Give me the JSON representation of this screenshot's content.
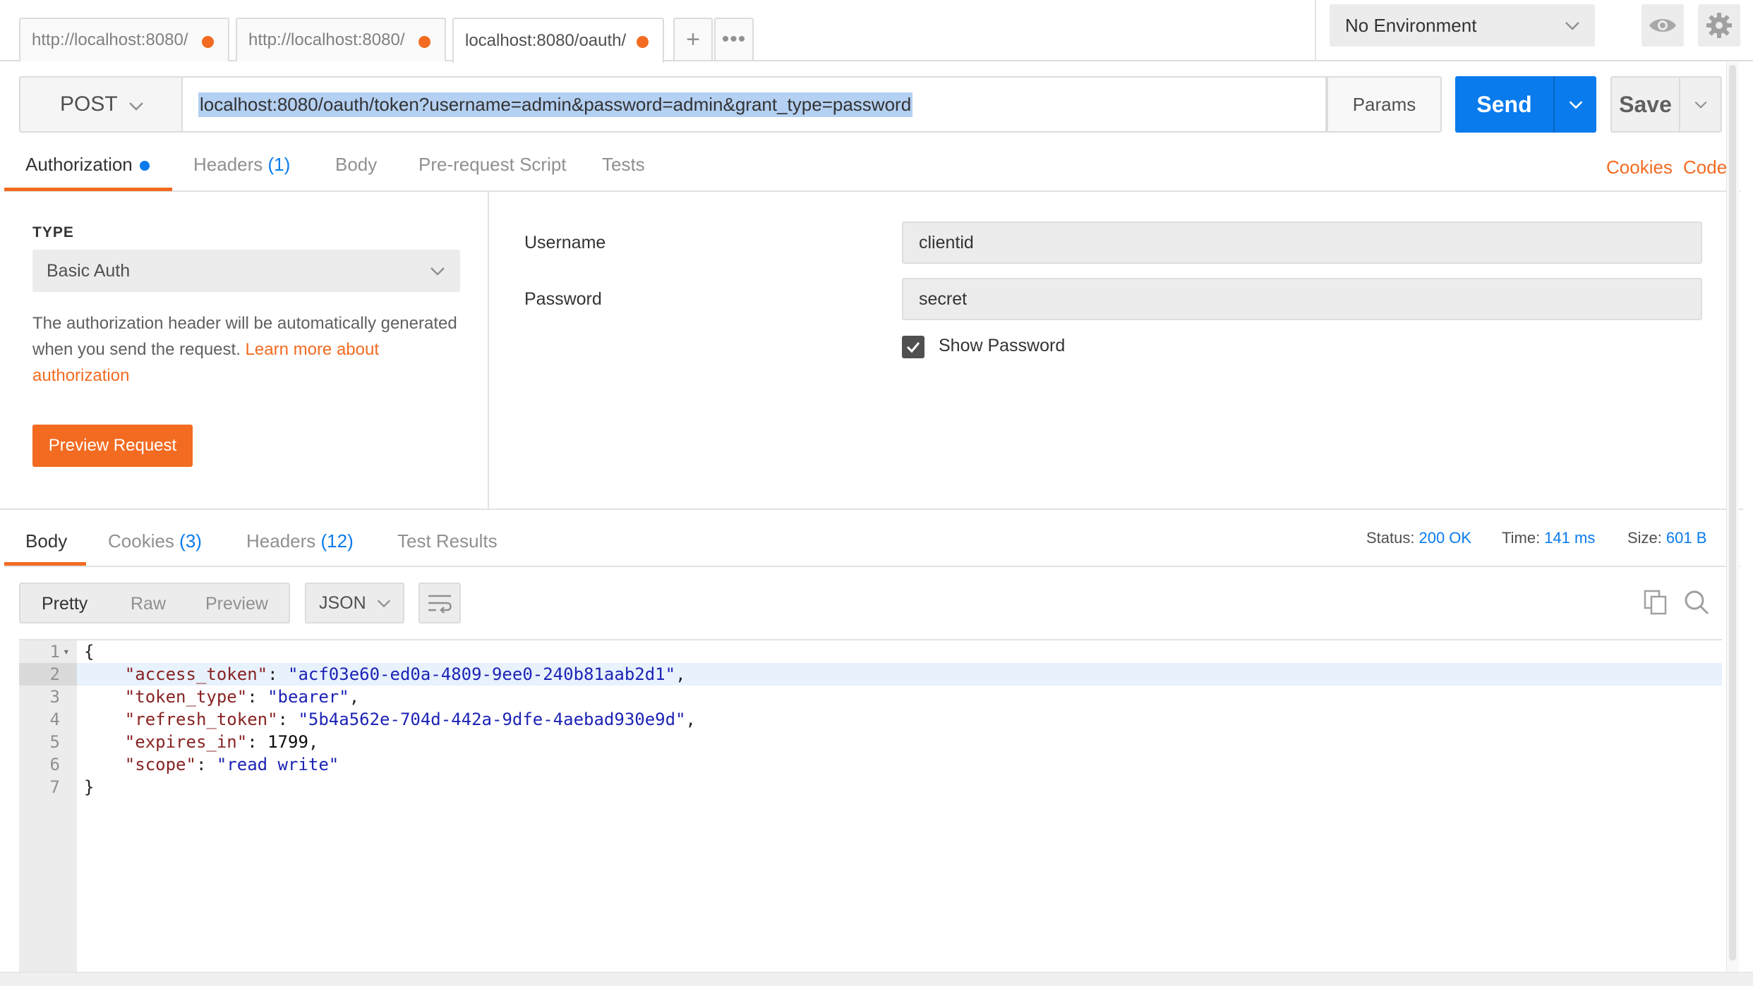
{
  "tabs": [
    {
      "label": "http://localhost:8080/"
    },
    {
      "label": "http://localhost:8080/"
    },
    {
      "label": "localhost:8080/oauth/"
    }
  ],
  "tab_buttons": {
    "new": "+",
    "more": "•••"
  },
  "environment": {
    "label": "No Environment"
  },
  "request": {
    "method": "POST",
    "url": "localhost:8080/oauth/token?username=admin&password=admin&grant_type=password",
    "params_label": "Params",
    "send_label": "Send",
    "save_label": "Save"
  },
  "request_tabs": {
    "authorization": "Authorization",
    "headers": "Headers",
    "headers_count": "(1)",
    "body": "Body",
    "pre_request": "Pre-request Script",
    "tests": "Tests",
    "cookies_link": "Cookies",
    "code_link": "Code"
  },
  "auth": {
    "type_label": "TYPE",
    "type_value": "Basic Auth",
    "desc_text": "The authorization header will be automatically generated when you send the request. ",
    "desc_link": "Learn more about authorization",
    "preview_label": "Preview Request",
    "username_label": "Username",
    "username_value": "clientid",
    "password_label": "Password",
    "password_value": "secret",
    "show_password_label": "Show Password"
  },
  "response_tabs": {
    "body": "Body",
    "cookies": "Cookies",
    "cookies_count": "(3)",
    "headers": "Headers",
    "headers_count": "(12)",
    "test_results": "Test Results"
  },
  "status": {
    "status_label": "Status:",
    "status_value": "200 OK",
    "time_label": "Time:",
    "time_value": "141 ms",
    "size_label": "Size:",
    "size_value": "601 B"
  },
  "view_modes": {
    "pretty": "Pretty",
    "raw": "Raw",
    "preview": "Preview"
  },
  "format": {
    "label": "JSON"
  },
  "code_lines": [
    {
      "n": "1",
      "open": "{"
    },
    {
      "n": "2",
      "key": "\"access_token\"",
      "sep": ": ",
      "val": "\"acf03e60-ed0a-4809-9ee0-240b81aab2d1\"",
      "tail": ","
    },
    {
      "n": "3",
      "key": "\"token_type\"",
      "sep": ": ",
      "val": "\"bearer\"",
      "tail": ","
    },
    {
      "n": "4",
      "key": "\"refresh_token\"",
      "sep": ": ",
      "val": "\"5b4a562e-704d-442a-9dfe-4aebad930e9d\"",
      "tail": ","
    },
    {
      "n": "5",
      "key": "\"expires_in\"",
      "sep": ": ",
      "val": "1799",
      "tail": ","
    },
    {
      "n": "6",
      "key": "\"scope\"",
      "sep": ": ",
      "val": "\"read write\"",
      "tail": ""
    },
    {
      "n": "7",
      "open": "}"
    }
  ],
  "colors": {
    "accent_orange": "#f26b21",
    "accent_blue": "#097bed",
    "json_key": "#882323",
    "json_string": "#1d23b5"
  }
}
